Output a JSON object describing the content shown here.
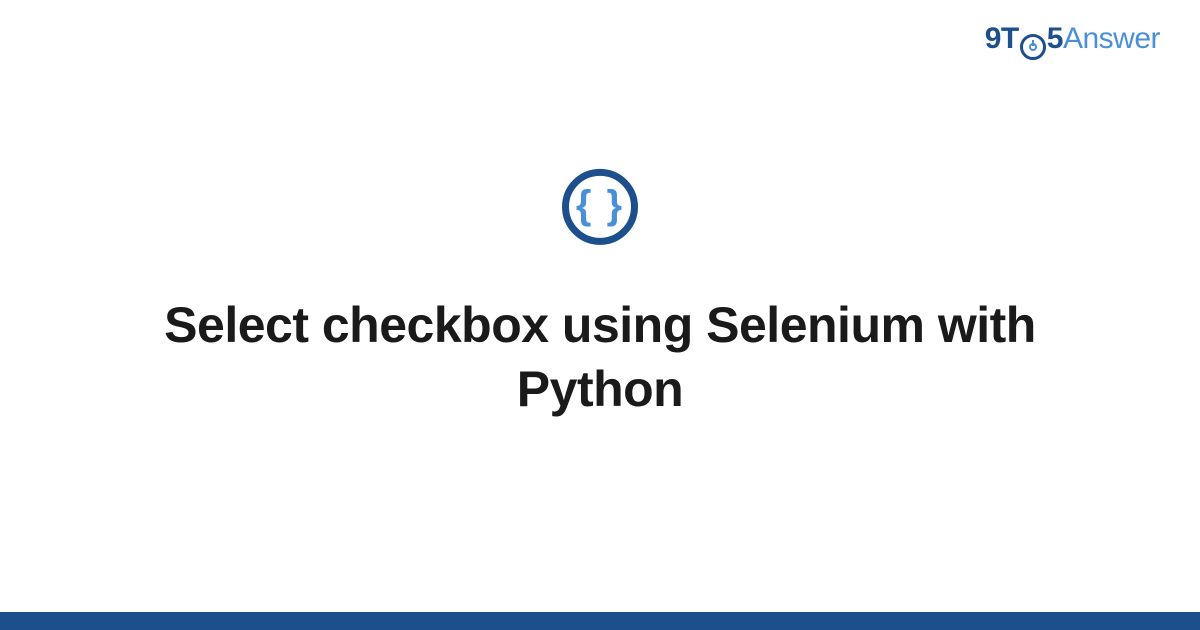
{
  "logo": {
    "part1": "9T",
    "part2": "5",
    "part3": "Answer"
  },
  "badge": {
    "braces": "{ }"
  },
  "title": "Select checkbox using Selenium with Python",
  "colors": {
    "primary": "#1d4f8c",
    "accent": "#4a90d9"
  }
}
